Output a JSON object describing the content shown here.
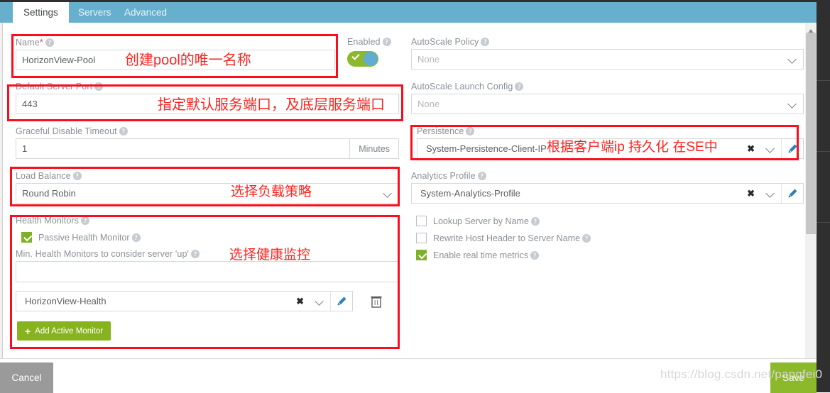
{
  "window": {
    "tabs": [
      {
        "label": "Settings",
        "active": true
      },
      {
        "label": "Servers",
        "active": false
      },
      {
        "label": "Advanced",
        "active": false
      }
    ]
  },
  "theme": {
    "tabbar_bg": "#66b0cd",
    "accent_green": "#8cb82b",
    "button_green": "#86b31e",
    "toggle_knob_blue": "#61acd2",
    "pencil_blue": "#2f7fb8",
    "annotation_red": "#fd2420",
    "redbox_border": "#fc0d1b",
    "cancel_gray": "#9a9a9a"
  },
  "left_column": {
    "name": {
      "label": "Name",
      "required_marker": "*",
      "help_icon": "help-circle-icon",
      "value": "HorizonView-Pool"
    },
    "default_server_port": {
      "label": "Default Server Port",
      "help_icon": "help-circle-icon",
      "value": "443"
    },
    "graceful_disable_timeout": {
      "label": "Graceful Disable Timeout",
      "help_icon": "help-circle-icon",
      "value": "1",
      "unit": "Minutes"
    },
    "load_balance": {
      "label": "Load Balance",
      "help_icon": "help-circle-icon",
      "value": "Round Robin",
      "dropdown_icon": "chevron-down-icon"
    },
    "health_monitors": {
      "label": "Health Monitors",
      "help_icon": "help-circle-icon",
      "passive": {
        "label": "Passive Health Monitor",
        "checked": true,
        "help_icon": "help-circle-icon"
      },
      "min_monitors": {
        "label": "Min. Health Monitors to consider server 'up'",
        "help_icon": "help-circle-icon",
        "value": ""
      },
      "selected_monitor": {
        "value": "HorizonView-Health",
        "clear_icon": "x-clear-icon",
        "dropdown_icon": "chevron-down-icon",
        "edit_icon": "pencil-icon",
        "delete_icon": "trash-icon"
      },
      "add_button": {
        "label": "Add Active Monitor",
        "plus_icon": "plus-icon"
      }
    }
  },
  "right_column": {
    "enabled": {
      "label": "Enabled",
      "help_icon": "help-circle-icon",
      "on": true
    },
    "autoscale_policy": {
      "label": "AutoScale Policy",
      "help_icon": "help-circle-icon",
      "placeholder": "None",
      "value": "",
      "dropdown_icon": "chevron-down-icon"
    },
    "autoscale_launch_config": {
      "label": "AutoScale Launch Config",
      "help_icon": "help-circle-icon",
      "placeholder": "None",
      "value": "",
      "dropdown_icon": "chevron-down-icon"
    },
    "persistence": {
      "label": "Persistence",
      "help_icon": "help-circle-icon",
      "value": "System-Persistence-Client-IP",
      "clear_icon": "x-clear-icon",
      "dropdown_icon": "chevron-down-icon",
      "edit_icon": "pencil-icon"
    },
    "analytics_profile": {
      "label": "Analytics Profile",
      "help_icon": "help-circle-icon",
      "value": "System-Analytics-Profile",
      "clear_icon": "x-clear-icon",
      "dropdown_icon": "chevron-down-icon",
      "edit_icon": "pencil-icon"
    },
    "checkboxes": [
      {
        "label": "Lookup Server by Name",
        "checked": false,
        "help_icon": "help-circle-icon"
      },
      {
        "label": "Rewrite Host Header to Server Name",
        "checked": false,
        "help_icon": "help-circle-icon"
      },
      {
        "label": "Enable real time metrics",
        "checked": true,
        "help_icon": "help-circle-icon"
      }
    ]
  },
  "annotations": [
    {
      "text": "创建pool的唯一名称",
      "font_size": 20
    },
    {
      "text": "指定默认服务端口，及底层服务端口",
      "font_size": 20
    },
    {
      "text": "根据客户端ip 持久化 在SE中",
      "font_size": 19
    },
    {
      "text": "选择负载策略",
      "font_size": 19
    },
    {
      "text": "选择健康监控",
      "font_size": 19
    }
  ],
  "footer": {
    "cancel_label": "Cancel",
    "save_label": "Save",
    "watermark": "https://blog.csdn.net/pangfei0"
  },
  "scrollbar": {
    "up_arrow_icon": "triangle-up-icon",
    "thumb": "scrollbar-thumb"
  }
}
